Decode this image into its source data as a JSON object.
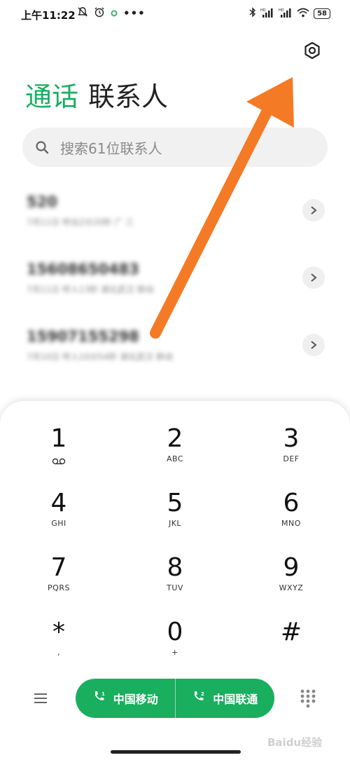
{
  "status_bar": {
    "time": "上午11:22",
    "left_icons": [
      "bell-off-icon",
      "alarm-icon",
      "notification-dot-icon",
      "more-dots-icon"
    ],
    "right_icons": [
      "bluetooth-icon",
      "signal-hd-icon",
      "signal-hd-icon",
      "wifi-icon"
    ],
    "battery": "58"
  },
  "tabs": {
    "calls": "通话",
    "contacts": "联系人"
  },
  "search": {
    "placeholder": "搜索61位联系人"
  },
  "recent_calls": [
    {
      "number": "520",
      "meta": "7月11日  呼出2分20秒  广 三"
    },
    {
      "number": "15608650483",
      "meta": "7月11日  呼入13秒  湖北武汉  移动"
    },
    {
      "number": "15907155298",
      "meta": "7月10日  呼入10分54秒  湖北武汉  移动"
    }
  ],
  "dialpad": {
    "keys": [
      {
        "digit": "1",
        "letters": ""
      },
      {
        "digit": "2",
        "letters": "ABC"
      },
      {
        "digit": "3",
        "letters": "DEF"
      },
      {
        "digit": "4",
        "letters": "GHI"
      },
      {
        "digit": "5",
        "letters": "JKL"
      },
      {
        "digit": "6",
        "letters": "MNO"
      },
      {
        "digit": "7",
        "letters": "PQRS"
      },
      {
        "digit": "8",
        "letters": "TUV"
      },
      {
        "digit": "9",
        "letters": "WXYZ"
      },
      {
        "digit": "*",
        "letters": ","
      },
      {
        "digit": "0",
        "letters": "+"
      },
      {
        "digit": "#",
        "letters": ""
      }
    ]
  },
  "call_buttons": {
    "sim1": "中国移动",
    "sim2": "中国联通"
  },
  "watermark": "Baidu经验",
  "colors": {
    "accent_green": "#1aae5f",
    "annotation_arrow": "#f47a26"
  }
}
